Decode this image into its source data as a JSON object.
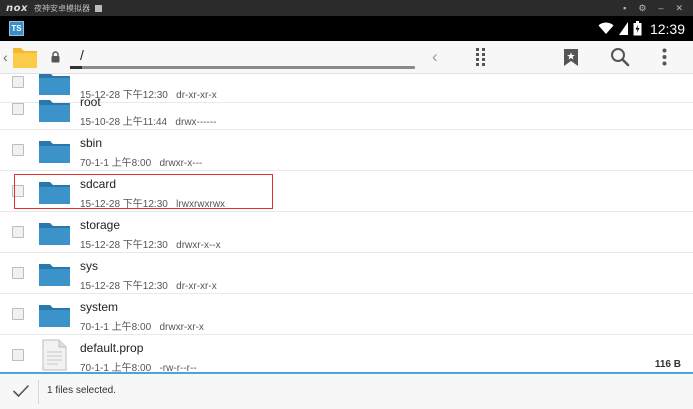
{
  "emulator": {
    "logo": "nox",
    "title": "夜神安卓模拟器"
  },
  "status_bar": {
    "app_badge": "TS",
    "time": "12:39"
  },
  "toolbar": {
    "path": "/"
  },
  "rows": [
    {
      "name": "",
      "meta": "15-12-28 下午12:30   dr-xr-xr-x",
      "type": "folder",
      "size": ""
    },
    {
      "name": "root",
      "meta": "15-10-28 上午11:44   drwx------",
      "type": "folder",
      "size": ""
    },
    {
      "name": "sbin",
      "meta": "70-1-1 上午8:00   drwxr-x---",
      "type": "folder",
      "size": ""
    },
    {
      "name": "sdcard",
      "meta": "15-12-28 下午12:30   lrwxrwxrwx",
      "type": "folder",
      "size": ""
    },
    {
      "name": "storage",
      "meta": "15-12-28 下午12:30   drwxr-x--x",
      "type": "folder",
      "size": ""
    },
    {
      "name": "sys",
      "meta": "15-12-28 下午12:30   dr-xr-xr-x",
      "type": "folder",
      "size": ""
    },
    {
      "name": "system",
      "meta": "70-1-1 上午8:00   drwxr-xr-x",
      "type": "folder",
      "size": ""
    },
    {
      "name": "default.prop",
      "meta": "70-1-1 上午8:00   -rw-r--r--",
      "type": "file",
      "size": "116 B"
    }
  ],
  "bottom_bar": {
    "selection_text": "1 files selected."
  },
  "colors": {
    "folder_blue": "#2f86be",
    "folder_yellow": "#f6b82d",
    "accent": "#4aa6d8",
    "highlight": "#e03030"
  }
}
